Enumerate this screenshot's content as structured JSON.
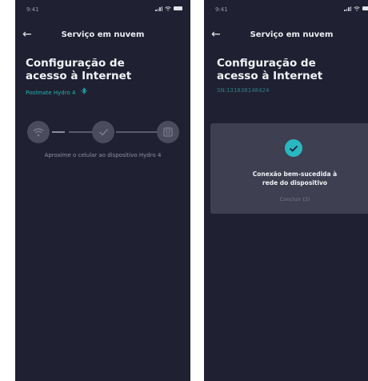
{
  "screens": [
    {
      "status_time": "9:41",
      "header_title": "Serviço em nuvem",
      "heading": "Configuração de acesso à Internet",
      "device_brand": "Poolmate",
      "device_model": "Hydro 4",
      "hint": "Aproxime o celular ao dispositivo Hydro 4",
      "steps_icons": [
        "wifi-icon",
        "check-icon",
        "device-icon"
      ]
    },
    {
      "status_time": "9:41",
      "header_title": "Serviço em nuvem",
      "heading": "Configuração de acesso à Internet",
      "serial": "SN:131838148424",
      "success_line1": "Conexão bem-sucedida à",
      "success_line2": "rede do dispositivo",
      "conclude_label": "Concluir (3)"
    }
  ],
  "colors": {
    "background": "#1f2031",
    "accent_teal": "#20b4b0",
    "check_circle": "#29b7c2",
    "card": "#3e3f50"
  }
}
